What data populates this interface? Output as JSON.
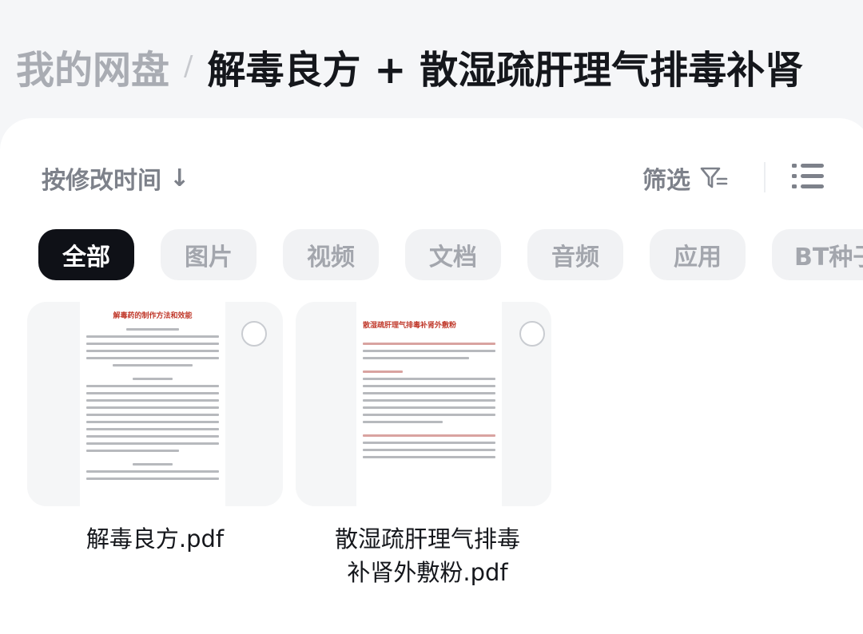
{
  "breadcrumb": {
    "root": "我的网盘",
    "separator": "/",
    "current": "解毒良方 + 散湿疏肝理气排毒补肾"
  },
  "toolbar": {
    "sort_label": "按修改时间",
    "sort_arrow": "↓",
    "filter_label": "筛选",
    "filter_icon": "filter-icon",
    "view_icon": "list-view-icon"
  },
  "tabs": [
    {
      "label": "全部",
      "active": true
    },
    {
      "label": "图片",
      "active": false
    },
    {
      "label": "视频",
      "active": false
    },
    {
      "label": "文档",
      "active": false
    },
    {
      "label": "音频",
      "active": false
    },
    {
      "label": "应用",
      "active": false
    },
    {
      "label": "BT种子",
      "active": false
    }
  ],
  "files": [
    {
      "name": "解毒良方.pdf",
      "thumb_title": "解毒药的制作方法和效能"
    },
    {
      "name_line1": "散湿疏肝理气排毒",
      "name_line2": "补肾外敷粉.pdf",
      "thumb_title": "散湿疏肝理气排毒补肾外敷粉"
    }
  ],
  "colors": {
    "active_tab": "#0f1117",
    "inactive_tab": "#f1f2f4",
    "muted_text": "#7d818a",
    "pdf_title_red": "#c0392b"
  }
}
